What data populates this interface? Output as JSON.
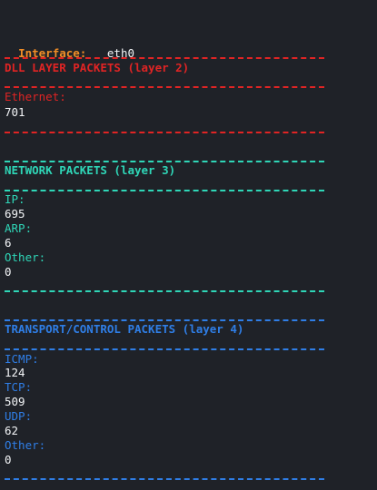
{
  "interface": {
    "label": "Interface:",
    "value": "eth0"
  },
  "dll": {
    "title": "DLL LAYER PACKETS (layer 2)",
    "ethernet_label": "Ethernet:",
    "ethernet_value": "701"
  },
  "network": {
    "title": "NETWORK PACKETS (layer 3)",
    "ip_label": "IP:",
    "ip_value": "695",
    "arp_label": "ARP:",
    "arp_value": "6",
    "other_label": "Other:",
    "other_value": "0"
  },
  "transport": {
    "title": "TRANSPORT/CONTROL PACKETS (layer 4)",
    "icmp_label": "ICMP:",
    "icmp_value": "124",
    "tcp_label": "TCP:",
    "tcp_value": "509",
    "udp_label": "UDP:",
    "udp_value": "62",
    "other_label": "Other:",
    "other_value": "0"
  },
  "colors": {
    "background": "#1f2228",
    "interface_label": "#f08d26",
    "dll": "#e02424",
    "network": "#2fd6b7",
    "transport": "#2f7ee6",
    "value_text": "#f2f4f6"
  }
}
